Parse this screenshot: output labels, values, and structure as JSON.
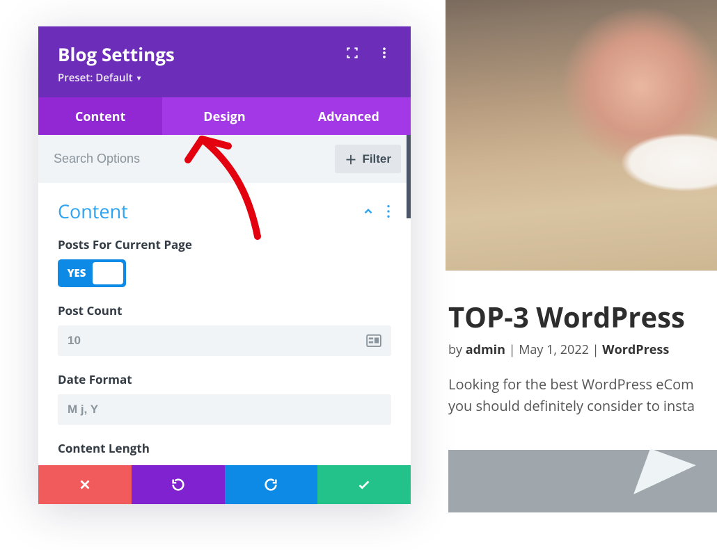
{
  "panel": {
    "title": "Blog Settings",
    "preset_label": "Preset: Default"
  },
  "tabs": {
    "content": "Content",
    "design": "Design",
    "advanced": "Advanced"
  },
  "search": {
    "placeholder": "Search Options",
    "filter_label": "Filter"
  },
  "section": {
    "title": "Content",
    "options": {
      "posts_current_page": {
        "label": "Posts For Current Page",
        "toggle_text": "YES"
      },
      "post_count": {
        "label": "Post Count",
        "value": "10"
      },
      "date_format": {
        "label": "Date Format",
        "value": "M j, Y"
      },
      "content_length": {
        "label": "Content Length"
      }
    }
  },
  "preview": {
    "title": "TOP-3 WordPress",
    "by_label": "by",
    "author": "admin",
    "sep": " | ",
    "date": "May 1, 2022",
    "category": "WordPress",
    "excerpt_line1": "Looking for the best WordPress eCom",
    "excerpt_line2": "you should definitely consider to insta"
  }
}
